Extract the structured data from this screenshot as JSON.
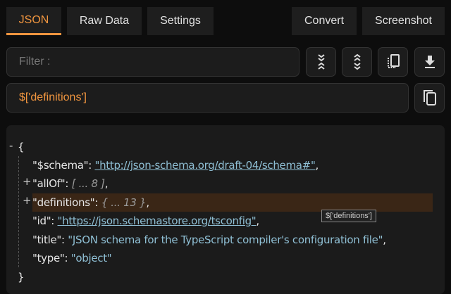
{
  "tabs": [
    {
      "label": "JSON",
      "active": true
    },
    {
      "label": "Raw Data"
    },
    {
      "label": "Settings"
    }
  ],
  "actions": {
    "convert": "Convert",
    "screenshot": "Screenshot"
  },
  "filter": {
    "placeholder": "Filter :",
    "value": ""
  },
  "path": {
    "value": "$['definitions']"
  },
  "toolbar_icons": [
    "collapse-all-icon",
    "expand-all-icon",
    "copy-icon",
    "download-icon"
  ],
  "accent": "#f0953f",
  "tree": {
    "open": "{",
    "close": "}",
    "collapse_toggle": "-",
    "rows": [
      {
        "key": "\"$schema\"",
        "value": "\"http://json-schema.org/draft-04/schema#\"",
        "kind": "link",
        "trail": ","
      },
      {
        "key": "\"allOf\"",
        "value": "[ ... 8 ]",
        "kind": "collapsed",
        "toggle": "+",
        "trail": ","
      },
      {
        "key": "\"definitions\"",
        "value": "{ ... 13 }",
        "kind": "collapsed",
        "toggle": "+",
        "trail": ","
      },
      {
        "key": "\"id\"",
        "value": "\"https://json.schemastore.org/tsconfig\"",
        "kind": "link",
        "trail": ","
      },
      {
        "key": "\"title\"",
        "value": "\"JSON schema for the TypeScript compiler's configuration file\"",
        "kind": "str",
        "trail": ","
      },
      {
        "key": "\"type\"",
        "value": "\"object\"",
        "kind": "str",
        "trail": ""
      }
    ],
    "tooltip": "$['definitions']"
  }
}
